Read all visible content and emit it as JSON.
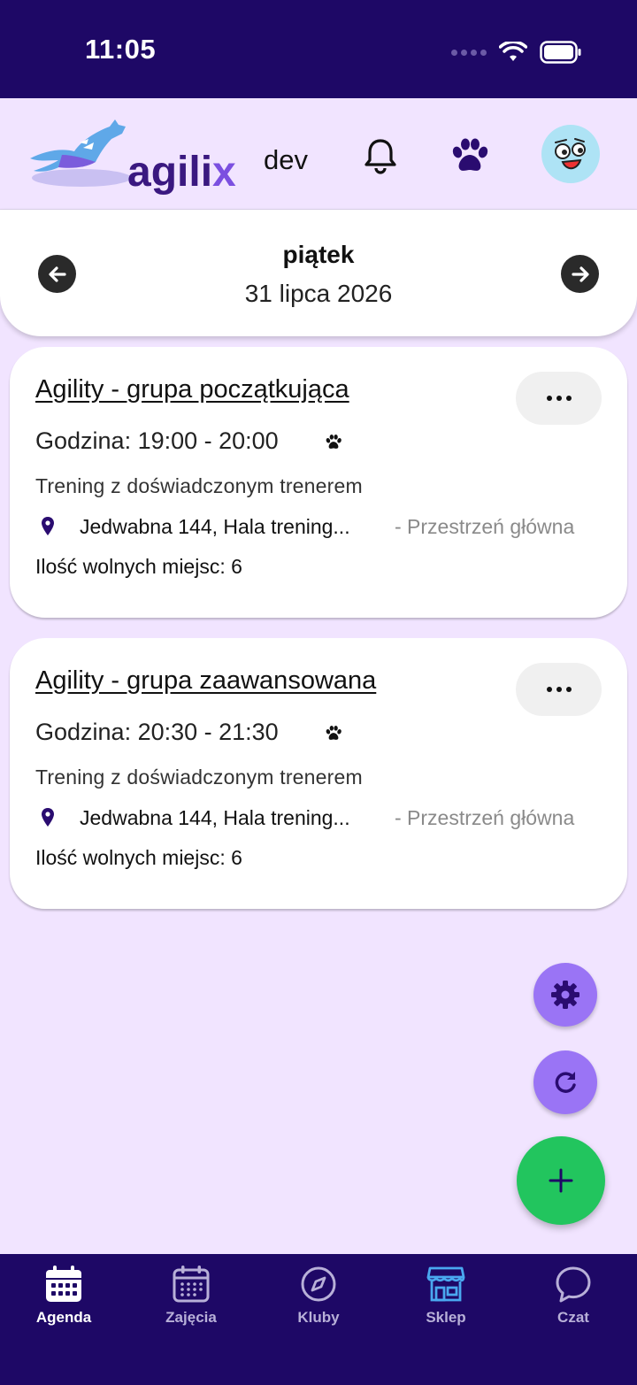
{
  "status_bar": {
    "time": "11:05"
  },
  "header": {
    "logo_text_main": "agili",
    "logo_text_accent": "x",
    "environment": "dev",
    "icons": [
      "bell-icon",
      "paw-icon",
      "avatar"
    ]
  },
  "date_nav": {
    "day_name": "piątek",
    "date": "31 lipca 2026"
  },
  "events": [
    {
      "title": "Agility - grupa początkująca",
      "time": "Godzina: 19:00 - 20:00",
      "description": "Trening z doświadczonym trenerem",
      "address": "Jedwabna 144, Hala trening...",
      "space": "- Przestrzeń główna",
      "seats": "Ilość wolnych miejsc: 6"
    },
    {
      "title": "Agility - grupa zaawansowana",
      "time": "Godzina: 20:30 - 21:30",
      "description": "Trening z doświadczonym trenerem",
      "address": "Jedwabna 144, Hala trening...",
      "space": "- Przestrzeń główna",
      "seats": "Ilość wolnych miejsc: 6"
    }
  ],
  "bottom_nav": [
    {
      "label": "Agenda",
      "icon": "calendar-icon",
      "active": true
    },
    {
      "label": "Zajęcia",
      "icon": "calendar-grid-icon",
      "active": false
    },
    {
      "label": "Kluby",
      "icon": "compass-icon",
      "active": false
    },
    {
      "label": "Sklep",
      "icon": "shop-icon",
      "active": false
    },
    {
      "label": "Czat",
      "icon": "chat-icon",
      "active": false
    }
  ],
  "colors": {
    "primary_dark": "#1e0866",
    "background": "#f1e4ff",
    "fab_purple": "#9a74f5",
    "fab_green": "#22c55e",
    "shop_icon": "#4aa8f0"
  }
}
